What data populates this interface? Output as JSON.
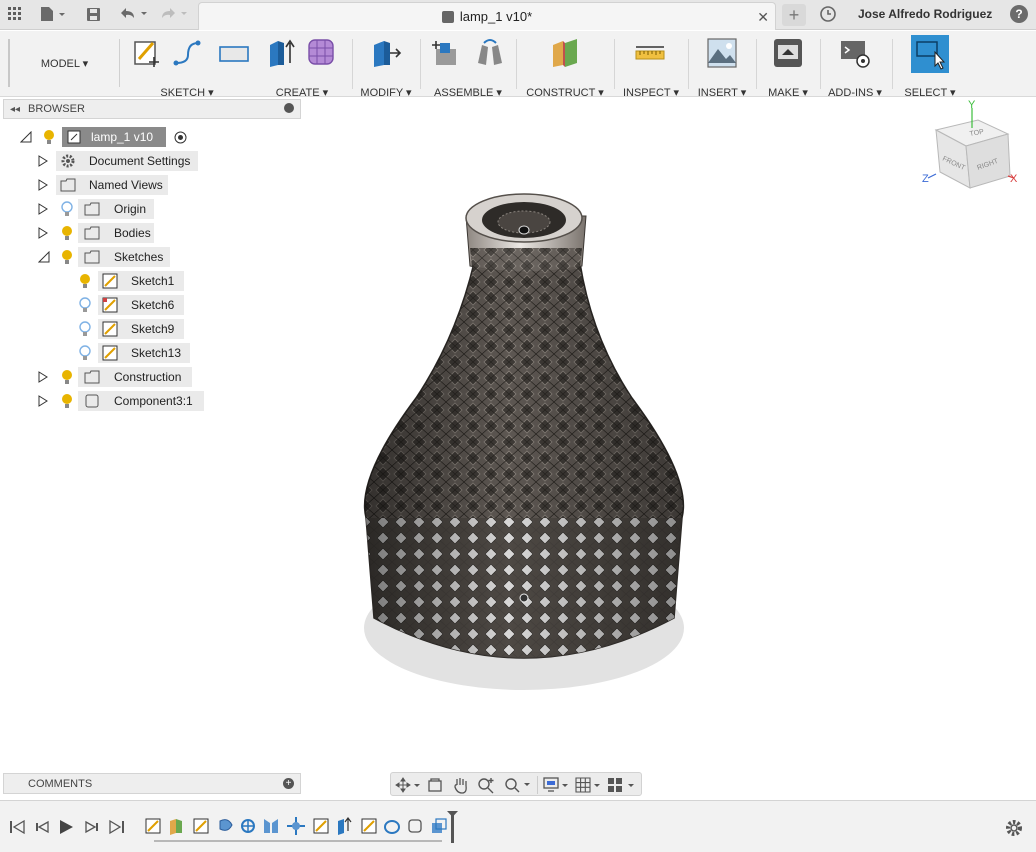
{
  "titlebar": {
    "tab_title": "lamp_1 v10*",
    "user_name": "Jose Alfredo Rodriguez",
    "help": "?"
  },
  "toolbar": {
    "workspace": "MODEL ▾",
    "groups": [
      {
        "label": "SKETCH ▾"
      },
      {
        "label": "CREATE ▾"
      },
      {
        "label": "MODIFY ▾"
      },
      {
        "label": "ASSEMBLE ▾"
      },
      {
        "label": "CONSTRUCT ▾"
      },
      {
        "label": "INSPECT ▾"
      },
      {
        "label": "INSERT ▾"
      },
      {
        "label": "MAKE ▾"
      },
      {
        "label": "ADD-INS ▾"
      },
      {
        "label": "SELECT ▾"
      }
    ]
  },
  "browser": {
    "title": "BROWSER",
    "items": [
      {
        "label": "lamp_1 v10"
      },
      {
        "label": "Document Settings"
      },
      {
        "label": "Named Views"
      },
      {
        "label": "Origin"
      },
      {
        "label": "Bodies"
      },
      {
        "label": "Sketches"
      },
      {
        "label": "Sketch1"
      },
      {
        "label": "Sketch6"
      },
      {
        "label": "Sketch9"
      },
      {
        "label": "Sketch13"
      },
      {
        "label": "Construction"
      },
      {
        "label": "Component3:1"
      }
    ]
  },
  "viewcube": {
    "top": "TOP",
    "front": "FRONT",
    "right": "RIGHT",
    "axis_x": "X",
    "axis_y": "Y",
    "axis_z": "Z"
  },
  "comments": {
    "title": "COMMENTS"
  },
  "colors": {
    "accent": "#1e88c8",
    "select_blue": "#2f8fd0",
    "bulb_yellow": "#e8b400",
    "bulb_blue": "#7fb2e5",
    "lamp_dark": "#4a4541"
  },
  "icons": {
    "apps": "grid-icon",
    "file": "file-icon",
    "save": "save-icon",
    "undo": "undo-icon",
    "redo": "redo-icon",
    "new_tab": "plus-icon",
    "clock": "clock-icon",
    "settings": "gear-icon"
  }
}
